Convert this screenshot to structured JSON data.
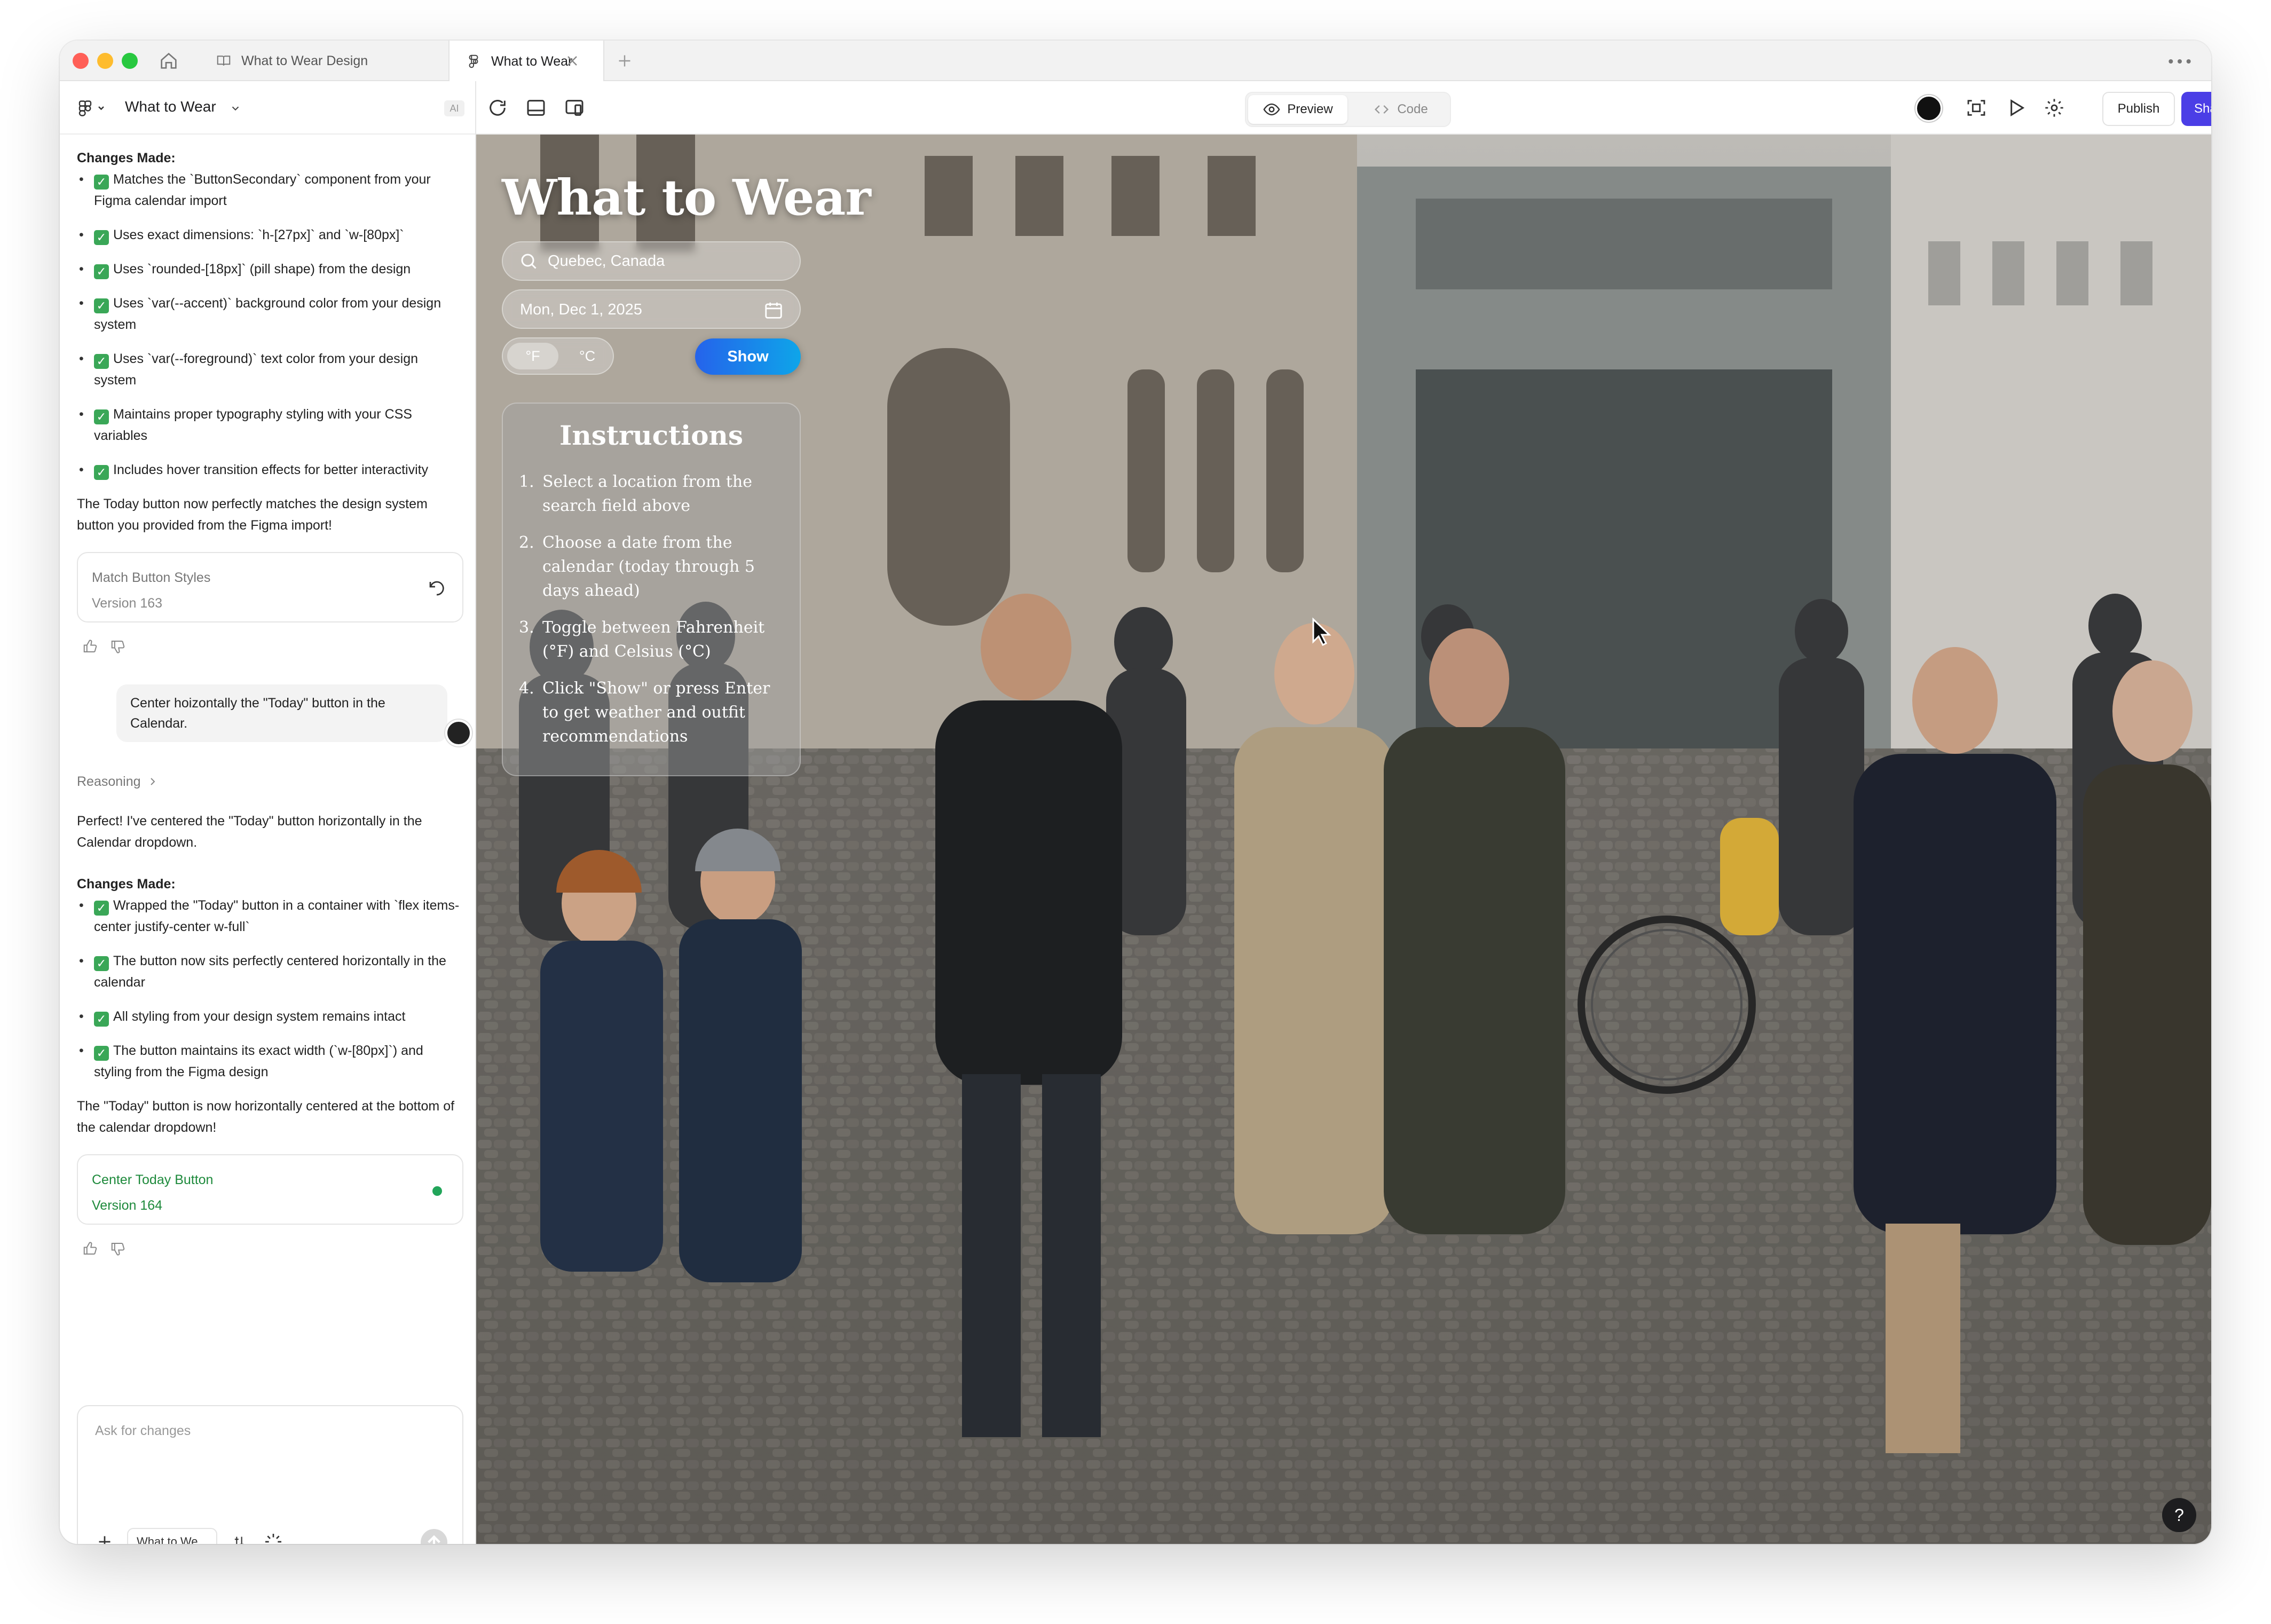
{
  "tabs": [
    {
      "label": "What to Wear Design"
    },
    {
      "label": "What to Wear"
    }
  ],
  "sidebar": {
    "project_name": "What to Wear",
    "ai_badge": "AI",
    "changes_heading": "Changes Made:",
    "changes_1": [
      "Matches the `ButtonSecondary` component from your Figma calendar import",
      "Uses exact dimensions: `h-[27px]` and `w-[80px]`",
      "Uses `rounded-[18px]` (pill shape) from the design",
      "Uses `var(--accent)` background color from your design system",
      "Uses `var(--foreground)` text color from your design system",
      "Maintains proper typography styling with your CSS variables",
      "Includes hover transition effects for better interactivity"
    ],
    "summary_1": "The Today button now perfectly matches the design system button you provided from the Figma import!",
    "version_1": {
      "title": "Match Button Styles",
      "version": "Version 163"
    },
    "user_message": "Center hoizontally the \"Today\" button in the Calendar.",
    "reasoning_label": "Reasoning",
    "reply_intro": "Perfect! I've centered the \"Today\" button horizontally in the Calendar dropdown.",
    "changes_2": [
      "Wrapped the \"Today\" button in a container with `flex items-center justify-center w-full`",
      "The button now sits perfectly centered horizontally in the calendar",
      "All styling from your design system remains intact",
      "The button maintains its exact width (`w-[80px]`) and styling from the Figma design"
    ],
    "summary_2": "The \"Today\" button is now horizontally centered at the bottom of the calendar dropdown!",
    "version_2": {
      "title": "Center Today Button",
      "version": "Version 164"
    },
    "input_placeholder": "Ask for changes",
    "context_chip": "What to We..."
  },
  "toolbar": {
    "preview_label": "Preview",
    "code_label": "Code",
    "publish_label": "Publish",
    "share_label": "Share"
  },
  "app": {
    "title": "What to Wear",
    "search_value": "Quebec, Canada",
    "date_value": "Mon, Dec 1, 2025",
    "unit_f": "°F",
    "unit_c": "°C",
    "show_label": "Show",
    "instructions_title": "Instructions",
    "instructions": [
      "Select a location from the search field above",
      "Choose a date from the calendar (today through 5 days ahead)",
      "Toggle between Fahrenheit (°F) and Celsius (°C)",
      "Click \"Show\" or press Enter to get weather and outfit recommendations"
    ],
    "help_label": "?"
  },
  "colors": {
    "share_button": "#4b3ee6",
    "show_button": "#2563eb",
    "version_active": "#1e8a3c",
    "check_badge": "#3aa757"
  }
}
